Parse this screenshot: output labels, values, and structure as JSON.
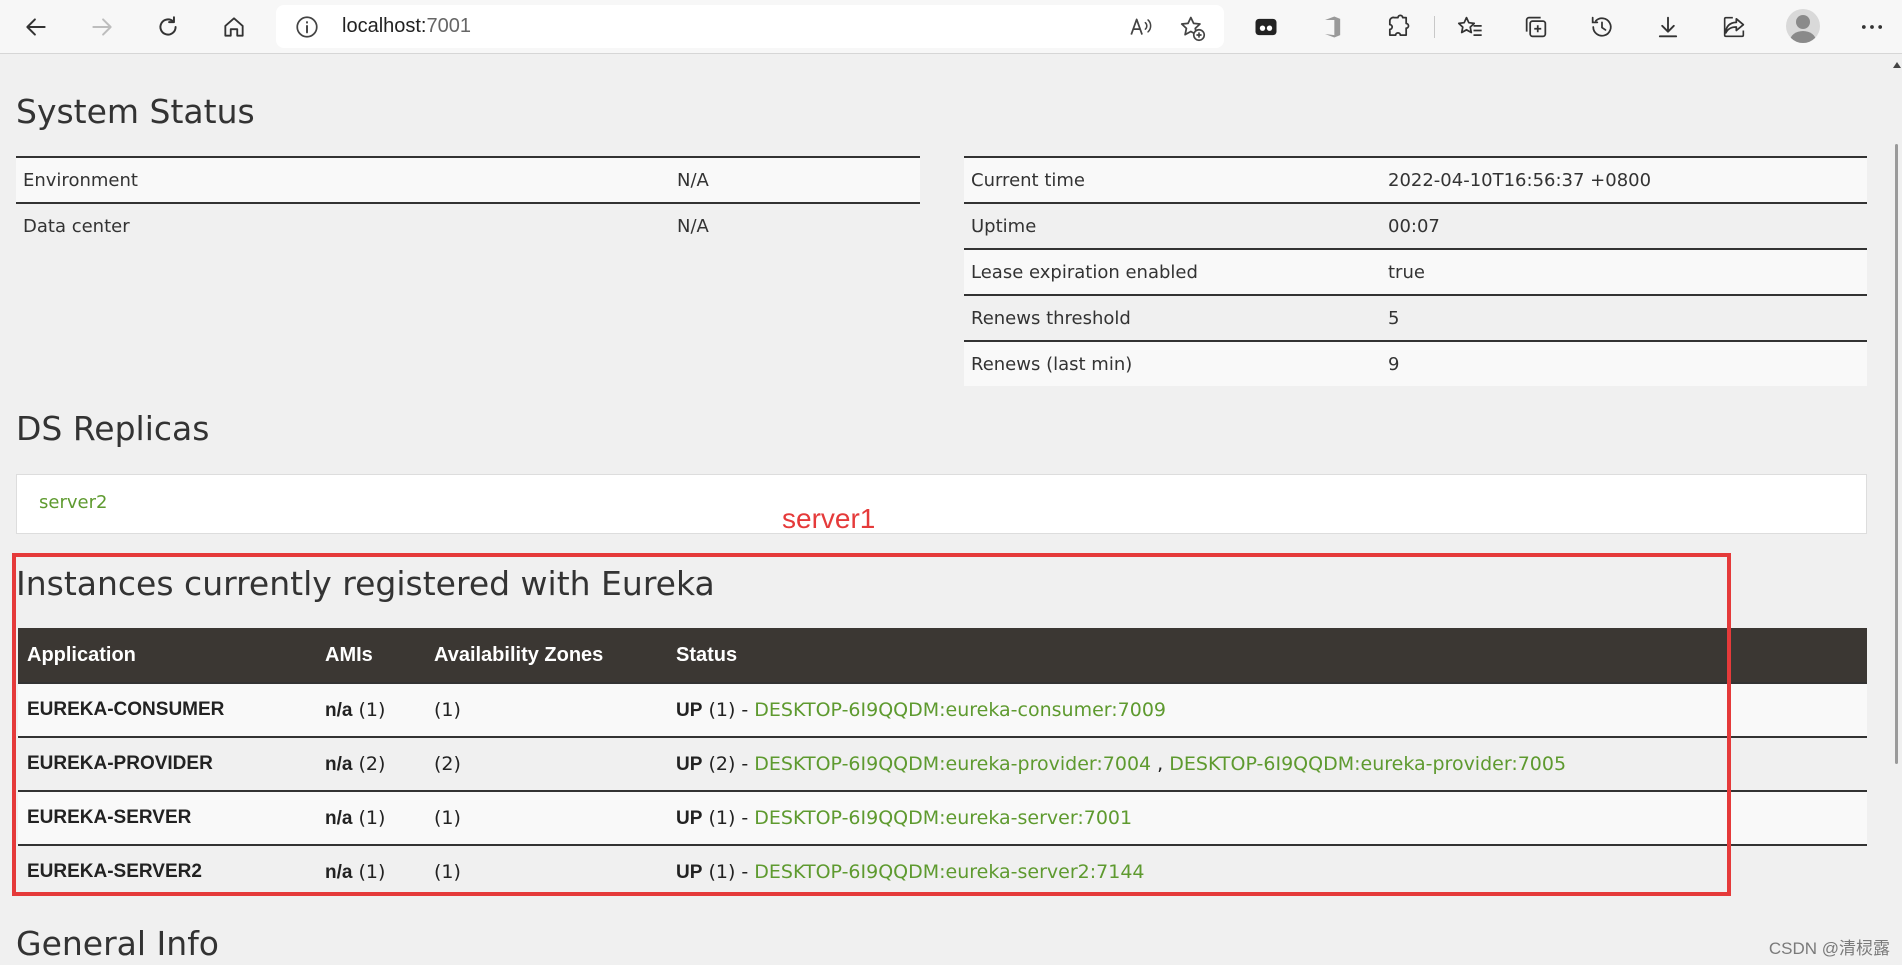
{
  "browser": {
    "url_host": "localhost:",
    "url_port": "7001",
    "icons": {
      "back": "back-arrow-icon",
      "forward": "forward-arrow-icon",
      "refresh": "refresh-icon",
      "home": "home-icon",
      "info": "info-icon",
      "read_aloud": "read-aloud-icon",
      "add_favorite": "add-favorite-icon",
      "more": "more-icon"
    }
  },
  "system_status": {
    "title": "System Status",
    "left": [
      {
        "label": "Environment",
        "value": "N/A"
      },
      {
        "label": "Data center",
        "value": "N/A"
      }
    ],
    "right": [
      {
        "label": "Current time",
        "value": "2022-04-10T16:56:37 +0800"
      },
      {
        "label": "Uptime",
        "value": "00:07"
      },
      {
        "label": "Lease expiration enabled",
        "value": "true"
      },
      {
        "label": "Renews threshold",
        "value": "5"
      },
      {
        "label": "Renews (last min)",
        "value": "9"
      }
    ]
  },
  "ds_replicas": {
    "title": "DS Replicas",
    "replica": "server2"
  },
  "annotation": {
    "label": "server1",
    "color": "#e53a3a"
  },
  "instances": {
    "title": "Instances currently registered with Eureka",
    "headers": [
      "Application",
      "AMIs",
      "Availability Zones",
      "Status"
    ],
    "rows": [
      {
        "app": "EUREKA-CONSUMER",
        "amis_bold": "n/a",
        "amis_count": " (1)",
        "zones": "(1)",
        "status_prefix": "UP",
        "status_count": " (1) - ",
        "links": [
          "DESKTOP-6I9QQDM:eureka-consumer:7009"
        ]
      },
      {
        "app": "EUREKA-PROVIDER",
        "amis_bold": "n/a",
        "amis_count": " (2)",
        "zones": "(2)",
        "status_prefix": "UP",
        "status_count": " (2) - ",
        "links": [
          "DESKTOP-6I9QQDM:eureka-provider:7004",
          "DESKTOP-6I9QQDM:eureka-provider:7005"
        ]
      },
      {
        "app": "EUREKA-SERVER",
        "amis_bold": "n/a",
        "amis_count": " (1)",
        "zones": "(1)",
        "status_prefix": "UP",
        "status_count": " (1) - ",
        "links": [
          "DESKTOP-6I9QQDM:eureka-server:7001"
        ]
      },
      {
        "app": "EUREKA-SERVER2",
        "amis_bold": "n/a",
        "amis_count": " (1)",
        "zones": "(1)",
        "status_prefix": "UP",
        "status_count": " (1) - ",
        "links": [
          "DESKTOP-6I9QQDM:eureka-server2:7144"
        ]
      }
    ],
    "link_separator": " , "
  },
  "general_info": {
    "title": "General Info"
  },
  "watermark": "CSDN @清棂露",
  "colors": {
    "link_green": "#5e9a2f",
    "header_dark": "#3b3733",
    "annotation_red": "#e53a3a"
  }
}
